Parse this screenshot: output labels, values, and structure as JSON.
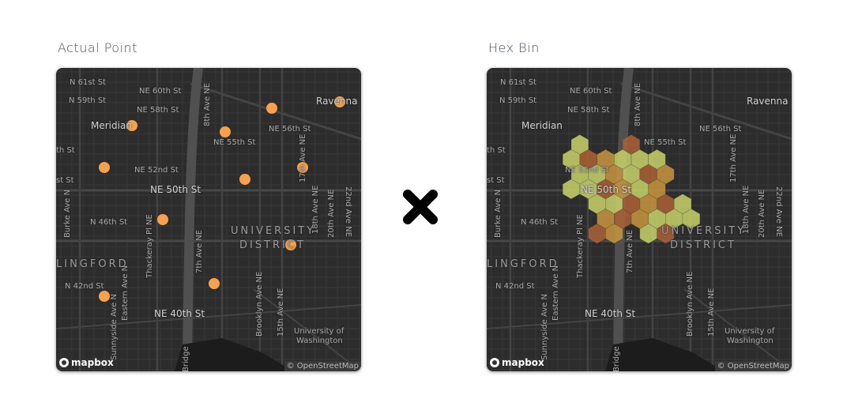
{
  "left": {
    "title": "Actual Point",
    "point_color": "#f7a14f"
  },
  "right": {
    "title": "Hex Bin",
    "bin_colors": {
      "low": "#c9d46b",
      "mid": "#c9963f",
      "high": "#ad6237"
    }
  },
  "separator_icon": "cross-icon",
  "map": {
    "labels": [
      "N 61st St",
      "NE 60th St",
      "N 59th St",
      "NE 58th St",
      "Meridian",
      "th St",
      "NE 52nd St",
      "st St",
      "NE 50th St",
      "N 46th St",
      "NE 55th St",
      "NE 56th St",
      "Ravenna Pa",
      "UNIVERSITY",
      "DISTRICT",
      "LINGFORD",
      "N 42nd St",
      "NE 40th St",
      "University of",
      "Washington",
      "Burke Ave N",
      "Thackeray Pl NE",
      "7th Ave NE",
      "8th Ave NE",
      "Brooklyn Ave NE",
      "15th Ave NE",
      "17th Ave NE",
      "18th Ave NE",
      "20th Ave NE",
      "22nd Ave NE",
      "Sunnyside Ave N",
      "Eastern Ave N",
      "Bridge"
    ],
    "logo_text": "mapbox",
    "attribution": "© OpenStreetMap"
  }
}
